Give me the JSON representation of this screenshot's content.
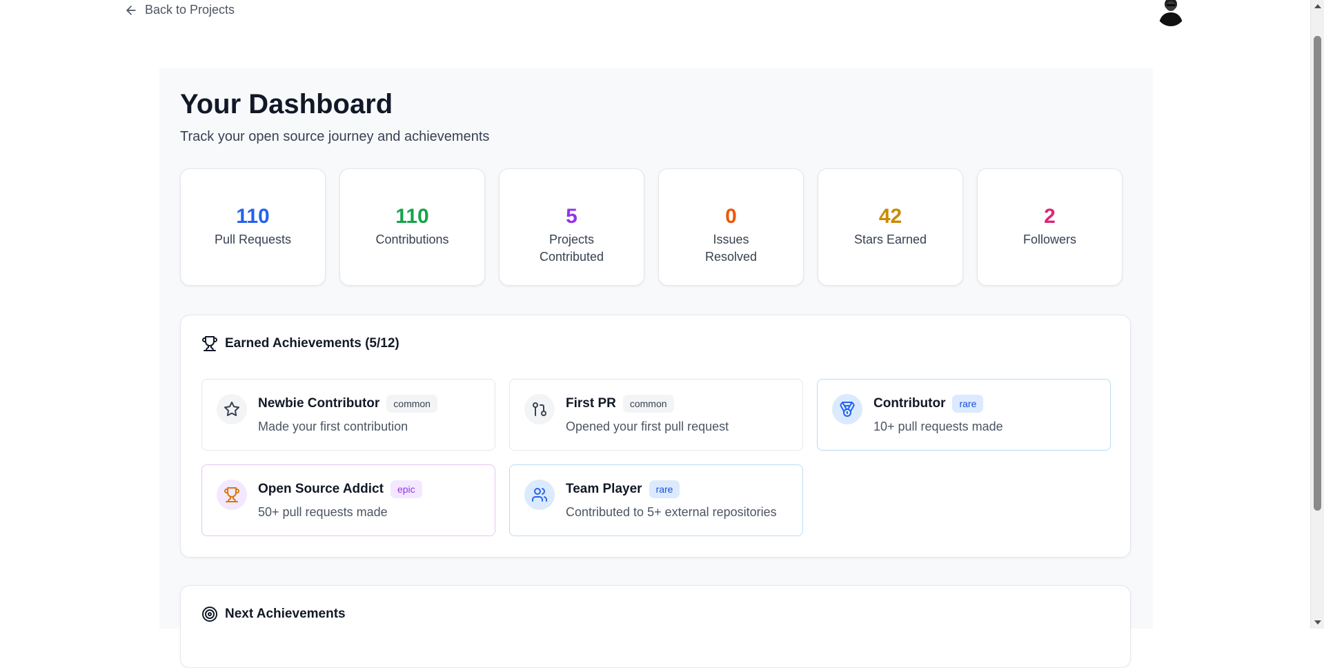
{
  "nav": {
    "back_label": "Back to Projects"
  },
  "header": {
    "title": "Your Dashboard",
    "subtitle": "Track your open source journey and achievements"
  },
  "stats": [
    {
      "value": "110",
      "label": "Pull Requests",
      "color": "#2563eb"
    },
    {
      "value": "110",
      "label": "Contributions",
      "color": "#16a34a"
    },
    {
      "value": "5",
      "label": "Projects Contributed",
      "color": "#9333ea"
    },
    {
      "value": "0",
      "label": "Issues Resolved",
      "color": "#ea580c"
    },
    {
      "value": "42",
      "label": "Stars Earned",
      "color": "#ca8a04"
    },
    {
      "value": "2",
      "label": "Followers",
      "color": "#db2777"
    }
  ],
  "earned": {
    "title": "Earned Achievements (5/12)",
    "icon": "trophy-icon",
    "items": [
      {
        "title": "Newbie Contributor",
        "rarity": "common",
        "desc": "Made your first contribution",
        "icon": "star-icon"
      },
      {
        "title": "First PR",
        "rarity": "common",
        "desc": "Opened your first pull request",
        "icon": "git-pull-request-icon"
      },
      {
        "title": "Contributor",
        "rarity": "rare",
        "desc": "10+ pull requests made",
        "icon": "medal-icon"
      },
      {
        "title": "Open Source Addict",
        "rarity": "epic",
        "desc": "50+ pull requests made",
        "icon": "trophy-icon"
      },
      {
        "title": "Team Player",
        "rarity": "rare",
        "desc": "Contributed to 5+ external repositories",
        "icon": "users-icon"
      }
    ]
  },
  "next": {
    "title": "Next Achievements",
    "icon": "target-icon"
  },
  "colors": {
    "common_badge": "#f3f4f6",
    "rare_badge": "#dbeafe",
    "epic_badge": "#f3e8ff",
    "rare_border": "#b9dcf4",
    "epic_border": "#e7c3f3"
  }
}
